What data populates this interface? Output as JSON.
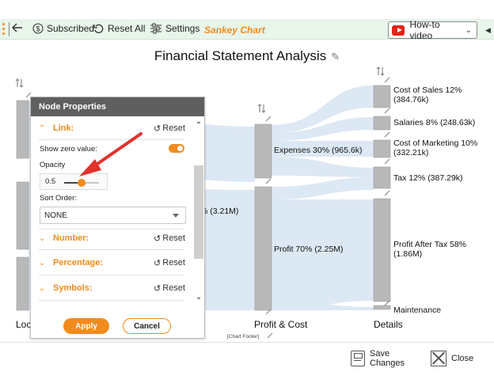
{
  "toolbar": {
    "subscribed_label": "Subscribed",
    "reset_all_label": "Reset All",
    "settings_label": "Settings",
    "app_title": "Sankey Chart",
    "howto_label": "How-to video",
    "accent_color": "#f28b1e",
    "icons": [
      "back-arrow-icon",
      "dollar-icon",
      "reset-icon",
      "settings-sliders-icon",
      "youtube-icon",
      "chevron-down-icon"
    ]
  },
  "chart": {
    "title": "Financial Statement Analysis",
    "footer": "[Chart Footer]",
    "axis_labels": [
      "Loc",
      "Profit & Cost",
      "Details"
    ],
    "node_labels": {
      "revenue_partial": "% (3.21M)",
      "expenses": "Expenses 30% (965.6k)",
      "profit": "Profit 70% (2.25M)",
      "cost_of_sales_1": "Cost of Sales 12%",
      "cost_of_sales_2": "(384.76k)",
      "salaries": "Salaries 8% (248.63k)",
      "marketing_1": "Cost of Marketing 10%",
      "marketing_2": "(332.21k)",
      "tax": "Tax 12% (387.29k)",
      "pat_1": "Profit After Tax 58%",
      "pat_2": "(1.86M)",
      "maintenance": "Maintenance"
    }
  },
  "chart_data": {
    "type": "sankey",
    "title": "Financial Statement Analysis",
    "columns": [
      "Loc",
      "Profit & Cost",
      "Details"
    ],
    "nodes": [
      {
        "name": "Expenses",
        "percent": 30,
        "value": "965.6k"
      },
      {
        "name": "Profit",
        "percent": 70,
        "value": "2.25M"
      },
      {
        "name": "Cost of Sales",
        "percent": 12,
        "value": "384.76k"
      },
      {
        "name": "Salaries",
        "percent": 8,
        "value": "248.63k"
      },
      {
        "name": "Cost of Marketing",
        "percent": 10,
        "value": "332.21k"
      },
      {
        "name": "Tax",
        "percent": 12,
        "value": "387.29k"
      },
      {
        "name": "Profit After Tax",
        "percent": 58,
        "value": "1.86M"
      },
      {
        "name": "Maintenance"
      }
    ]
  },
  "panel": {
    "header": "Node Properties",
    "link_label": "Link:",
    "reset_label": "Reset",
    "show_zero_label": "Show zero value:",
    "show_zero_on": true,
    "opacity_label": "Opacity",
    "opacity_value": "0.5",
    "opacity_fraction": 0.5,
    "sort_order_label": "Sort Order:",
    "sort_order_value": "NONE",
    "sections": [
      "Number:",
      "Percentage:",
      "Symbols:"
    ],
    "apply_label": "Apply",
    "cancel_label": "Cancel"
  },
  "footer": {
    "save_label_1": "Save",
    "save_label_2": "Changes",
    "close_label": "Close"
  }
}
